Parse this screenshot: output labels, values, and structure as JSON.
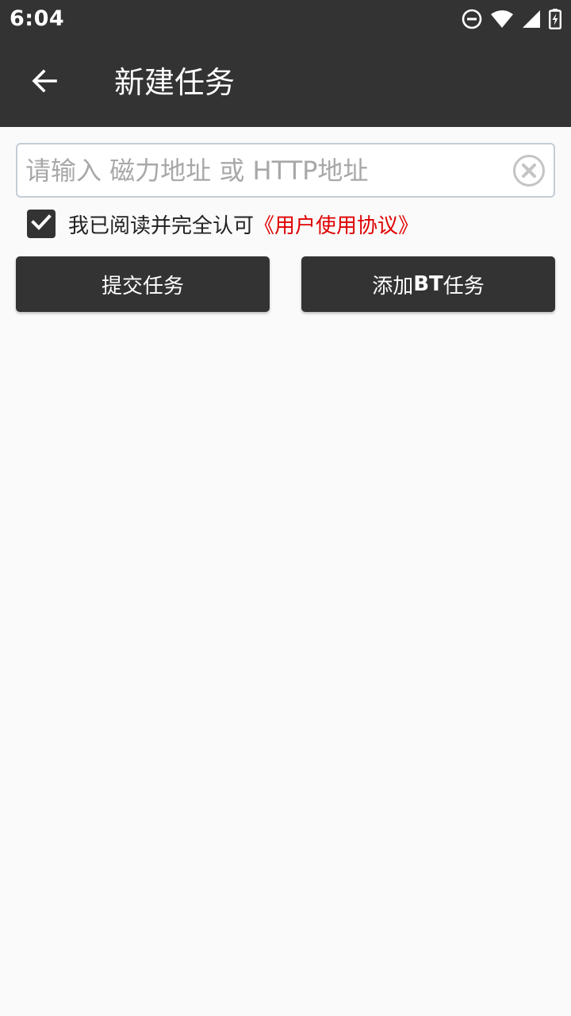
{
  "status_bar": {
    "time": "6:04",
    "icons": [
      "do-not-disturb-icon",
      "wifi-icon",
      "signal-icon",
      "battery-charging-icon"
    ]
  },
  "app_bar": {
    "title": "新建任务",
    "back_icon": "arrow-left-icon"
  },
  "url_input": {
    "value": "",
    "placeholder": "请输入 磁力地址 或 HTTP地址",
    "clear_icon": "clear-circle-icon"
  },
  "agreement": {
    "checked": true,
    "text": "我已阅读并完全认可",
    "link_text": "《用户使用协议》",
    "link_color": "#e00000"
  },
  "buttons": {
    "submit_label": "提交任务",
    "add_bt_prefix": "添加",
    "add_bt_bold": "BT",
    "add_bt_suffix": "任务"
  },
  "colors": {
    "bar_background": "#333333",
    "page_background": "#fafafa"
  }
}
